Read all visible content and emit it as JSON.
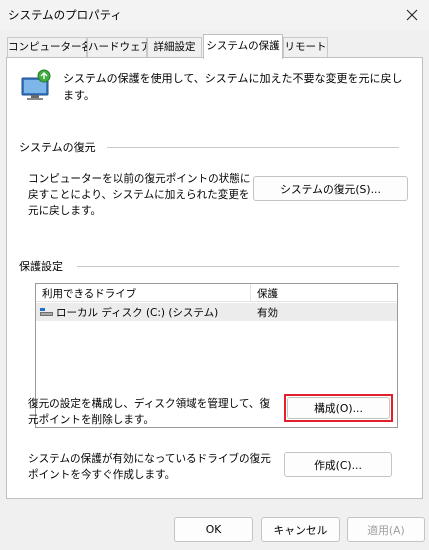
{
  "window": {
    "title": "システムのプロパティ",
    "close_icon": "×"
  },
  "tabs": [
    {
      "label": "コンピューター名"
    },
    {
      "label": "ハードウェア"
    },
    {
      "label": "詳細設定"
    },
    {
      "label": "システムの保護"
    },
    {
      "label": "リモート"
    }
  ],
  "active_tab": "システムの保護",
  "intro": {
    "text": "システムの保護を使用して、システムに加えた不要な変更を元に戻します。"
  },
  "restore": {
    "title": "システムの復元",
    "desc": "コンピューターを以前の復元ポイントの状態に戻すことにより、システムに加えられた変更を元に戻します。",
    "button": "システムの復元(S)..."
  },
  "protection": {
    "title": "保護設定",
    "columns": [
      "利用できるドライブ",
      "保護"
    ],
    "drives": [
      {
        "name": "ローカル ディスク (C:) (システム)",
        "status": "有効"
      }
    ],
    "configure_desc": "復元の設定を構成し、ディスク領域を管理して、復元ポイントを削除します。",
    "configure_button": "構成(O)...",
    "create_desc": "システムの保護が有効になっているドライブの復元ポイントを今すぐ作成します。",
    "create_button": "作成(C)..."
  },
  "footer": {
    "ok": "OK",
    "cancel": "キャンセル",
    "apply": "適用(A)"
  },
  "colors": {
    "highlight": "#e2202c",
    "panel_bg": "#ffffff",
    "window_bg": "#f0f0f0"
  }
}
